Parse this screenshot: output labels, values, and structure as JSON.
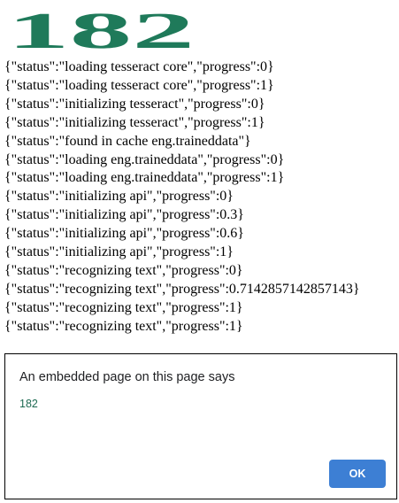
{
  "image": {
    "text": "182",
    "color": "#1f7a5a"
  },
  "log": [
    "{\"status\":\"loading tesseract core\",\"progress\":0}",
    "{\"status\":\"loading tesseract core\",\"progress\":1}",
    "{\"status\":\"initializing tesseract\",\"progress\":0}",
    "{\"status\":\"initializing tesseract\",\"progress\":1}",
    "{\"status\":\"found in cache eng.traineddata\"}",
    "{\"status\":\"loading eng.traineddata\",\"progress\":0}",
    "{\"status\":\"loading eng.traineddata\",\"progress\":1}",
    "{\"status\":\"initializing api\",\"progress\":0}",
    "{\"status\":\"initializing api\",\"progress\":0.3}",
    "{\"status\":\"initializing api\",\"progress\":0.6}",
    "{\"status\":\"initializing api\",\"progress\":1}",
    "{\"status\":\"recognizing text\",\"progress\":0}",
    "{\"status\":\"recognizing text\",\"progress\":0.7142857142857143}",
    "{\"status\":\"recognizing text\",\"progress\":1}",
    "{\"status\":\"recognizing text\",\"progress\":1}"
  ],
  "dialog": {
    "title": "An embedded page on this page says",
    "message": "182",
    "ok_label": "OK",
    "message_color": "#1e6a52",
    "button_color": "#3d7fd4"
  }
}
